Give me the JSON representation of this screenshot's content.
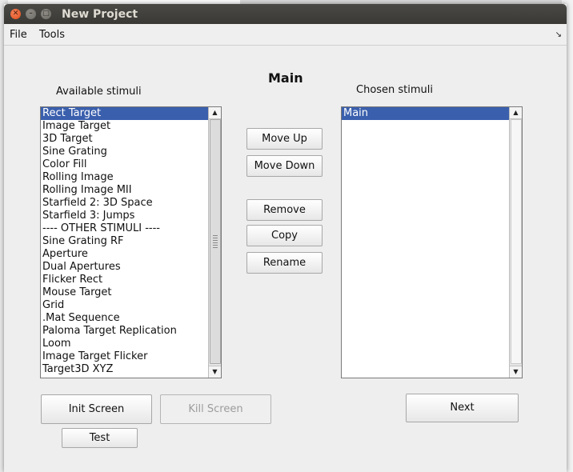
{
  "window": {
    "title": "New Project"
  },
  "menu": {
    "file": "File",
    "tools": "Tools",
    "dock_glyph": "↘"
  },
  "panel_title": "Main",
  "available": {
    "label": "Available stimuli",
    "items": [
      "Rect Target",
      "Image Target",
      "3D Target",
      "Sine Grating",
      "Color Fill",
      "Rolling Image",
      "Rolling Image MII",
      "Starfield 2: 3D Space",
      "Starfield 3: Jumps",
      "---- OTHER STIMULI ----",
      "Sine Grating RF",
      "Aperture",
      "Dual Apertures",
      "Flicker Rect",
      "Mouse Target",
      "Grid",
      ".Mat Sequence",
      "Paloma Target Replication",
      "Loom",
      "Image Target Flicker",
      "Target3D XYZ"
    ],
    "selected": "Rect Target"
  },
  "chosen": {
    "label": "Chosen stimuli",
    "items": [
      "Main"
    ],
    "selected": "Main"
  },
  "buttons": {
    "move_up": "Move Up",
    "move_down": "Move Down",
    "remove": "Remove",
    "copy": "Copy",
    "rename": "Rename",
    "init_screen": "Init Screen",
    "kill_screen": "Kill Screen",
    "test": "Test",
    "next": "Next"
  },
  "colors": {
    "selection": "#3a5fad",
    "titlebar": "#3c3b37",
    "close_button": "#e2541c"
  }
}
